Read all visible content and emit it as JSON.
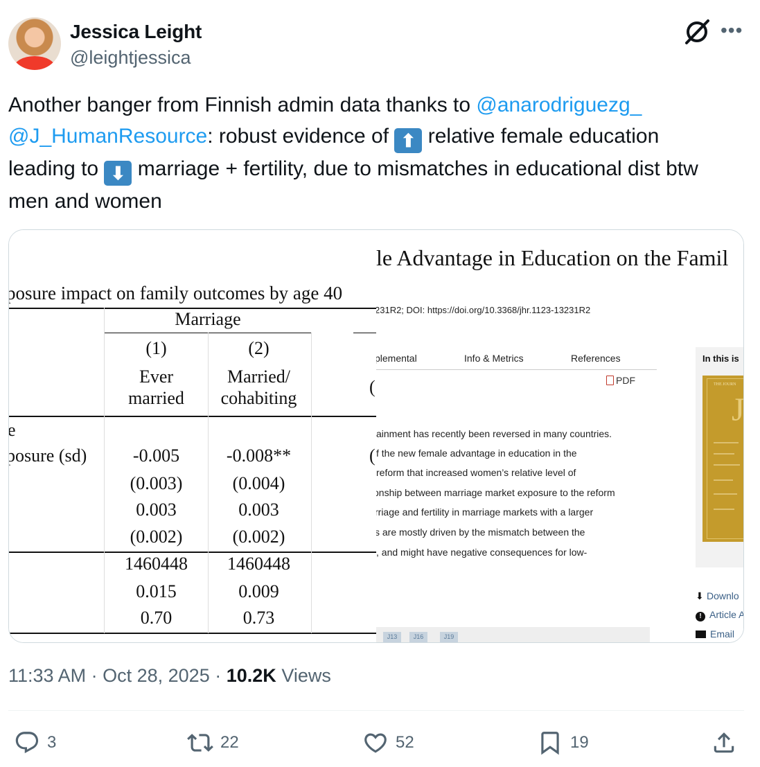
{
  "author": {
    "name": "Jessica Leight",
    "handle": "@leightjessica"
  },
  "tweet": {
    "p1": "Another banger from Finnish admin data thanks to ",
    "mention1": "@anarodriguezg_",
    "mention2": "@J_HumanResource",
    "p2": ": robust evidence of ",
    "up_emoji": "⬆",
    "p3": " relative female education leading to ",
    "down_emoji": "⬇",
    "p4": " marriage + fertility, due to mismatches in educational dist btw men and women"
  },
  "media_left": {
    "title": "posure impact on family outcomes by age 40",
    "group_header": "Marriage",
    "col1_num": "(1)",
    "col2_num": "(2)",
    "col1_l1": "Ever",
    "col1_l2": "married",
    "col2_l1": "Married/",
    "col2_l2": "cohabiting",
    "edge_paren": "(",
    "row_label_a": "e",
    "row_label_b": "posure (sd)",
    "c1_v1": "-0.005",
    "c2_v1": "-0.008**",
    "c1_v2": "(0.003)",
    "c2_v2": "(0.004)",
    "c1_v3": "0.003",
    "c2_v3": "0.003",
    "c1_v4": "(0.002)",
    "c2_v4": "(0.002)",
    "c1_v5": "1460448",
    "c2_v5": "1460448",
    "c1_v6": "0.015",
    "c2_v6": "0.009",
    "c1_v7": "0.70",
    "c2_v7": "0.73"
  },
  "media_right": {
    "title": "le Advantage in Education on the Famil",
    "doi": "231R2; DOI: https://doi.org/10.3368/jhr.1123-13231R2",
    "tabs": [
      "plemental",
      "Info & Metrics",
      "References"
    ],
    "pdf": "PDF",
    "abstract_lines": [
      "ainment has recently been reversed in many countries.",
      "f the new female advantage in education in the",
      "reform that increased women’s relative level of",
      "onship between marriage market exposure to the reform",
      "rriage and fertility in marriage markets with a larger",
      "s are mostly driven by the mismatch between the",
      ", and might have negative consequences for low-"
    ],
    "sidebar_title": "In this is",
    "cover_text": "THE JOURN",
    "cover_letter": "J",
    "sidebar_links": [
      "Downlo",
      "Article A",
      "Email"
    ],
    "jel_tags": [
      "J13",
      "J16",
      "J19"
    ]
  },
  "meta": {
    "time": "11:33 AM",
    "date": "Oct 28, 2025",
    "views_count": "10.2K",
    "views_label": "Views",
    "sep": "·"
  },
  "actions": {
    "replies": "3",
    "reposts": "22",
    "likes": "52",
    "bookmarks": "19"
  }
}
